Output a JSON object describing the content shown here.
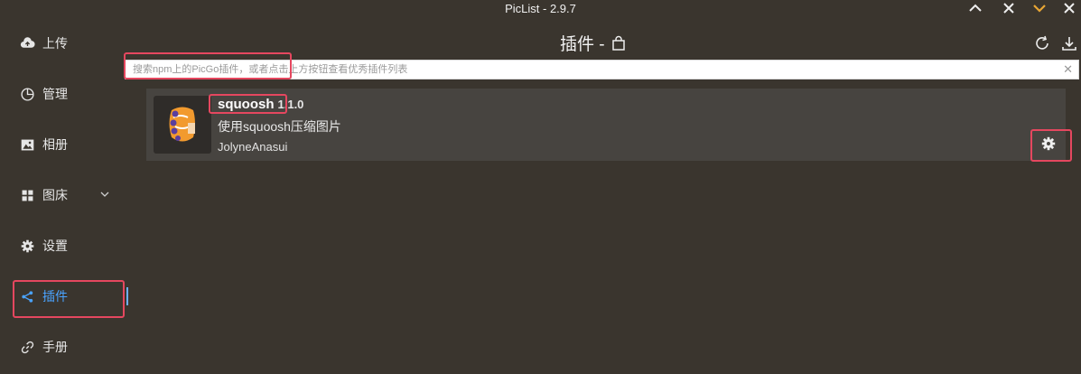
{
  "window": {
    "title": "PicList - 2.9.7"
  },
  "sidebar": {
    "items": [
      {
        "label": "上传",
        "icon": "cloud-upload-icon"
      },
      {
        "label": "管理",
        "icon": "pie-chart-icon"
      },
      {
        "label": "相册",
        "icon": "image-icon"
      },
      {
        "label": "图床",
        "icon": "grid-icon"
      },
      {
        "label": "设置",
        "icon": "gear-icon"
      },
      {
        "label": "插件",
        "icon": "share-icon",
        "active": true
      },
      {
        "label": "手册",
        "icon": "link-icon"
      }
    ]
  },
  "header": {
    "title": "插件 -",
    "icons": [
      "shopping-bag-icon",
      "refresh-icon",
      "download-icon"
    ]
  },
  "search": {
    "placeholder": "搜索npm上的PicGo插件，或者点击上方按钮查看优秀插件列表",
    "value": ""
  },
  "plugin": {
    "name": "squoosh",
    "version": "1.1.0",
    "description": "使用squoosh压缩图片",
    "author": "JolyneAnasui"
  },
  "colors": {
    "background": "#3a352e",
    "card": "#474440",
    "accent": "#4aa3ff",
    "highlight": "#e5475f",
    "minimize_accent": "#e8a634"
  }
}
